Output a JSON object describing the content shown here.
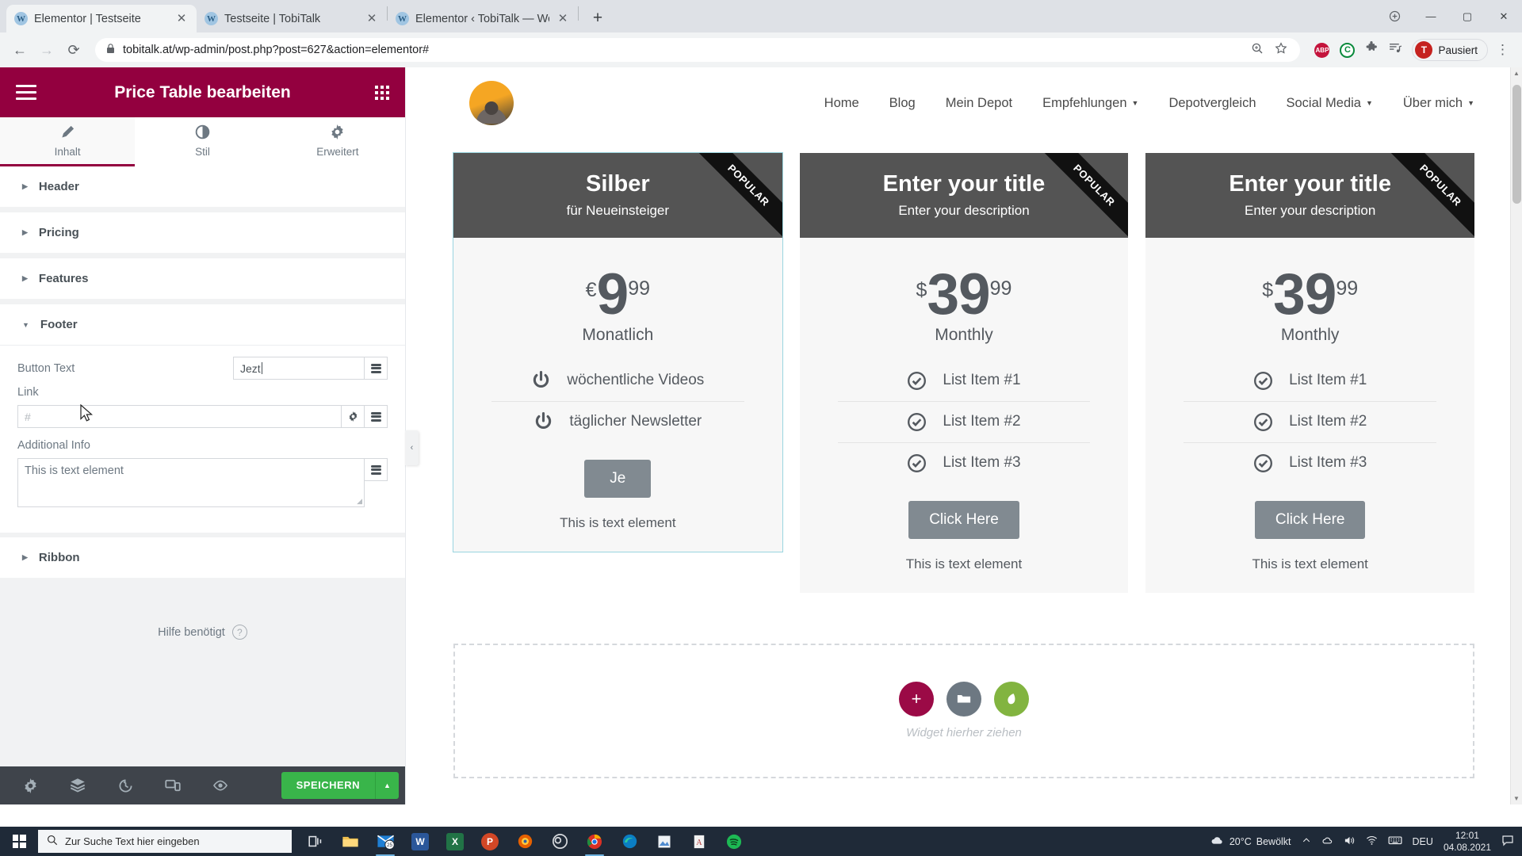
{
  "browser": {
    "tabs": [
      {
        "title": "Elementor | Testseite",
        "active": true,
        "icon": "wordpress-icon"
      },
      {
        "title": "Testseite | TobiTalk",
        "active": false,
        "icon": "wordpress-icon"
      },
      {
        "title": "Elementor ‹ TobiTalk — WordPre:",
        "active": false,
        "icon": "wordpress-icon"
      }
    ],
    "new_tab_label": "+",
    "window_controls": {
      "minimize": "—",
      "maximize": "▢",
      "close": "✕"
    },
    "nav": {
      "back": "←",
      "forward": "→",
      "reload": "⟳"
    },
    "url": "tobitalk.at/wp-admin/post.php?post=627&action=elementor#",
    "lock": "🔒",
    "toolbar_icons": [
      "zoom-icon",
      "bookmark-star-icon",
      "adblock-plus-icon",
      "ghostery-icon",
      "extensions-puzzle-icon",
      "reading-list-icon"
    ],
    "profile": {
      "initial": "T",
      "label": "Pausiert"
    },
    "menu": "⋮"
  },
  "editor": {
    "title": "Price Table bearbeiten",
    "tabs": [
      {
        "label": "Inhalt",
        "icon": "pencil-icon",
        "active": true
      },
      {
        "label": "Stil",
        "icon": "contrast-icon",
        "active": false
      },
      {
        "label": "Erweitert",
        "icon": "gear-icon",
        "active": false
      }
    ],
    "sections": [
      {
        "label": "Header",
        "expanded": false
      },
      {
        "label": "Pricing",
        "expanded": false
      },
      {
        "label": "Features",
        "expanded": false
      },
      {
        "label": "Footer",
        "expanded": true
      },
      {
        "label": "Ribbon",
        "expanded": false
      }
    ],
    "footer_controls": {
      "button_text_label": "Button Text",
      "button_text_value": "Jezt",
      "link_label": "Link",
      "link_value": "#",
      "additional_info_label": "Additional Info",
      "additional_info_value": "This is text element"
    },
    "help": {
      "text": "Hilfe benötigt",
      "icon": "question-mark-icon"
    },
    "bottom_bar": {
      "icons": [
        "settings-gear-icon",
        "navigator-layers-icon",
        "history-revisions-icon",
        "responsive-mode-icon",
        "preview-eye-icon"
      ],
      "save_label": "SPEICHERN",
      "save_caret": "▲",
      "save_color": "#39b54a"
    },
    "collapse_handle": "‹",
    "accent_color": "#93003f"
  },
  "site": {
    "logo": "profile-avatar",
    "nav_items": [
      {
        "label": "Home",
        "has_dropdown": false
      },
      {
        "label": "Blog",
        "has_dropdown": false
      },
      {
        "label": "Mein Depot",
        "has_dropdown": false
      },
      {
        "label": "Empfehlungen",
        "has_dropdown": true
      },
      {
        "label": "Depotvergleich",
        "has_dropdown": false
      },
      {
        "label": "Social Media",
        "has_dropdown": true
      },
      {
        "label": "Über mich",
        "has_dropdown": true
      }
    ],
    "cards": [
      {
        "title": "Silber",
        "subtitle": "für Neueinsteiger",
        "ribbon": "POPULAR",
        "currency": "€",
        "integer": "9",
        "fraction": "99",
        "period": "Monatlich",
        "features": [
          {
            "label": "wöchentliche Videos",
            "icon": "power-icon"
          },
          {
            "label": "täglicher Newsletter",
            "icon": "power-icon"
          }
        ],
        "button": "Je",
        "footer_text": "This is text element",
        "selected": true
      },
      {
        "title": "Enter your title",
        "subtitle": "Enter your description",
        "ribbon": "POPULAR",
        "currency": "$",
        "integer": "39",
        "fraction": "99",
        "period": "Monthly",
        "features": [
          {
            "label": "List Item #1",
            "icon": "check-circle-icon"
          },
          {
            "label": "List Item #2",
            "icon": "check-circle-icon"
          },
          {
            "label": "List Item #3",
            "icon": "check-circle-icon"
          }
        ],
        "button": "Click Here",
        "footer_text": "This is text element",
        "selected": false
      },
      {
        "title": "Enter your title",
        "subtitle": "Enter your description",
        "ribbon": "POPULAR",
        "currency": "$",
        "integer": "39",
        "fraction": "99",
        "period": "Monthly",
        "features": [
          {
            "label": "List Item #1",
            "icon": "check-circle-icon"
          },
          {
            "label": "List Item #2",
            "icon": "check-circle-icon"
          },
          {
            "label": "List Item #3",
            "icon": "check-circle-icon"
          }
        ],
        "button": "Click Here",
        "footer_text": "This is text element",
        "selected": false
      }
    ],
    "add_section": {
      "hint": "Widget hierher ziehen",
      "buttons": [
        {
          "name": "add-new-section",
          "glyph": "+",
          "color": "#9b0a46"
        },
        {
          "name": "add-template-folder",
          "glyph": "▬",
          "color": "#6d7882"
        },
        {
          "name": "add-envato-kit",
          "glyph": "◗",
          "color": "#82b440"
        }
      ]
    }
  },
  "taskbar": {
    "search_placeholder": "Zur Suche Text hier eingeben",
    "search_icon": "magnifier-icon",
    "start_icon": "windows-logo-icon",
    "apps": [
      {
        "name": "task-view-icon",
        "glyph": "❏",
        "color": "#1f2a38"
      },
      {
        "name": "file-explorer-icon",
        "glyph": "▰",
        "color": "#f2c14e"
      },
      {
        "name": "mail-icon",
        "glyph": "25",
        "color": "#0f6cbd"
      },
      {
        "name": "word-icon",
        "glyph": "W",
        "color": "#2b579a"
      },
      {
        "name": "excel-icon",
        "glyph": "X",
        "color": "#217346"
      },
      {
        "name": "powerpoint-icon",
        "glyph": "P",
        "color": "#d24726"
      },
      {
        "name": "firefox-icon",
        "glyph": "◉",
        "color": "#e66000"
      },
      {
        "name": "obs-icon",
        "glyph": "◎",
        "color": "#3a3a3a"
      },
      {
        "name": "chrome-icon",
        "glyph": "◍",
        "color": "#d93025"
      },
      {
        "name": "edge-icon",
        "glyph": "◐",
        "color": "#0b7ec4"
      },
      {
        "name": "photos-icon",
        "glyph": "▨",
        "color": "#4f8bd0"
      },
      {
        "name": "acrobat-icon",
        "glyph": "▤",
        "color": "#b33a3a"
      },
      {
        "name": "spotify-icon",
        "glyph": "♫",
        "color": "#1db954"
      }
    ],
    "weather": {
      "temp": "20°C",
      "text": "Bewölkt",
      "icon": "cloud-icon"
    },
    "tray_icons": [
      "chevron-up-icon",
      "onedrive-icon",
      "volume-icon",
      "network-icon",
      "keyboard-icon"
    ],
    "language": "DEU",
    "time": "12:01",
    "date": "04.08.2021",
    "action_center": "notification-icon"
  }
}
